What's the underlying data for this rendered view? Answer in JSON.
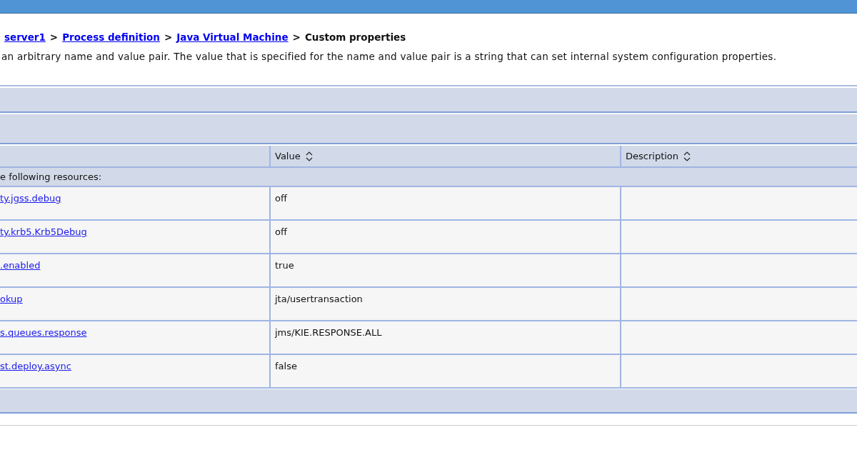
{
  "breadcrumb": [
    {
      "label": "server1",
      "kind": "link"
    },
    {
      "label": ">",
      "kind": "separator"
    },
    {
      "label": "Process definition",
      "kind": "link"
    },
    {
      "label": ">",
      "kind": "separator"
    },
    {
      "label": "Java Virtual Machine",
      "kind": "link"
    },
    {
      "label": ">",
      "kind": "separator"
    },
    {
      "label": "Custom properties",
      "kind": "current"
    }
  ],
  "description": "an arbitrary name and value pair. The value that is specified for the name and value pair is a string that can set internal system configuration properties.",
  "table": {
    "columns": [
      {
        "sortable": false
      },
      {
        "label": "Value",
        "sortable": true
      },
      {
        "label": "Description",
        "sortable": true
      }
    ],
    "group_row": "e following resources:",
    "rows": [
      {
        "name": "ty.jgss.debug",
        "value": "off"
      },
      {
        "name": "ty.krb5.Krb5Debug",
        "value": "off"
      },
      {
        "name": ".enabled",
        "value": "true"
      },
      {
        "name": "okup",
        "value": "jta/usertransaction"
      },
      {
        "name": "s.queues.response",
        "value": "jms/KIE.RESPONSE.ALL"
      },
      {
        "name": "st.deploy.async",
        "value": "false"
      }
    ]
  }
}
